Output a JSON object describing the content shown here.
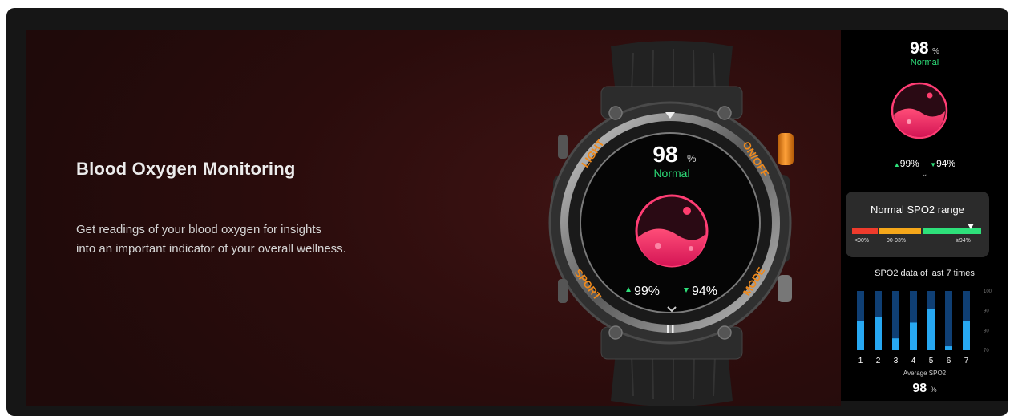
{
  "title": "Blood Oxygen Monitoring",
  "description": [
    "Get readings of your blood oxygen for insights",
    "into an important indicator of your overall wellness."
  ],
  "watch": {
    "value": "98",
    "unit": "%",
    "status": "Normal",
    "max": "99%",
    "min": "94%",
    "buttons": {
      "light": "LIGHT",
      "on_off": "ON/OFF",
      "sport": "SPORT",
      "mode": "MODE"
    }
  },
  "panel": {
    "value": "98",
    "unit": "%",
    "status": "Normal",
    "max": "99%",
    "min": "94%",
    "range_title": "Normal SPO2 range",
    "range_labels": [
      "<90%",
      "90-93%",
      "≥94%"
    ],
    "history_title": "SPO2 data of last 7 times",
    "history": {
      "x": [
        "1",
        "2",
        "3",
        "4",
        "5",
        "6",
        "7"
      ],
      "values": [
        85,
        87,
        76,
        84,
        91,
        72,
        85
      ],
      "y_ticks": [
        "100",
        "90",
        "80",
        "70"
      ],
      "ylim": [
        70,
        100
      ]
    },
    "avg_label": "Average SPO2",
    "avg_value": "98",
    "avg_unit": "%"
  },
  "colors": {
    "accent_green": "#2ee07a",
    "bar_blue": "#27a8f2",
    "bar_track": "#0f3f74",
    "orange": "#f08a1c",
    "drop_pink": "#f0306a"
  }
}
